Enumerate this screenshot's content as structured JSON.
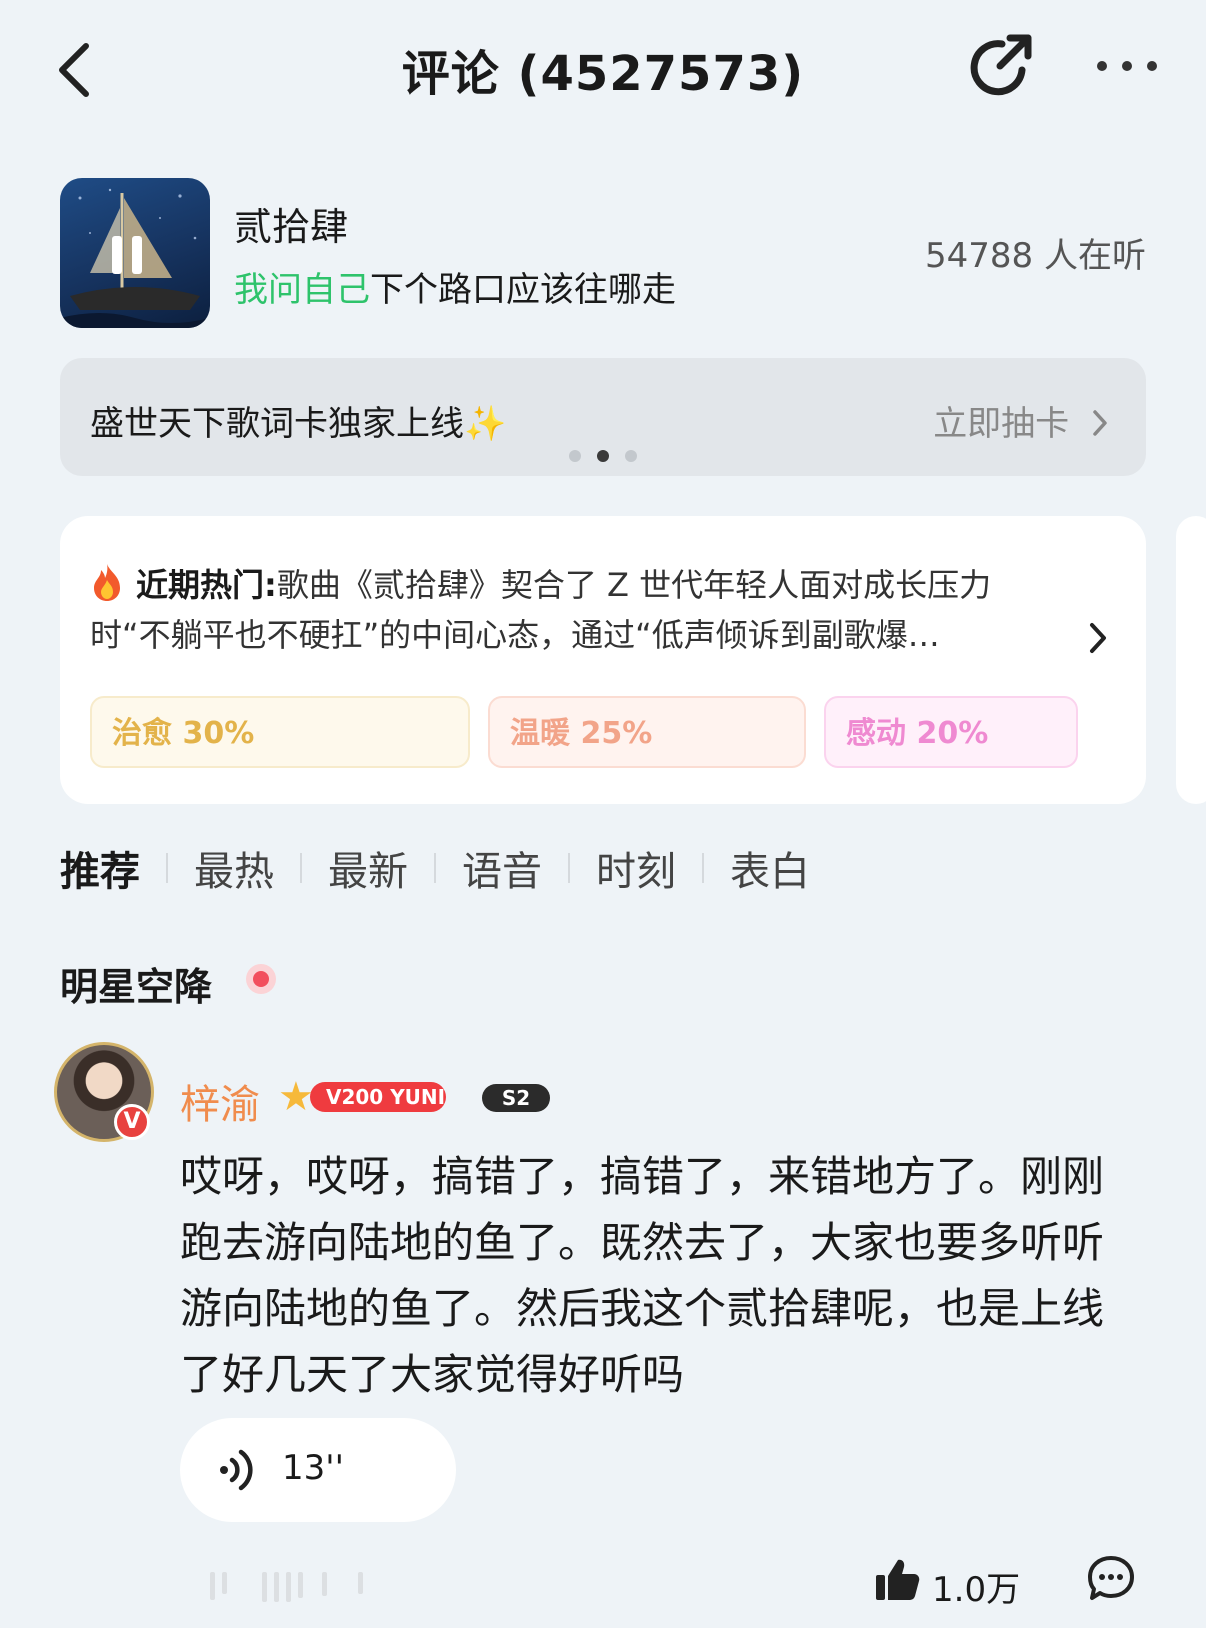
{
  "header": {
    "title": "评论 (4527573)"
  },
  "song": {
    "title": "贰拾肆",
    "lyric_highlight": "我问自己",
    "lyric_rest": "下个路口应该往哪走",
    "listeners": "54788 人在听"
  },
  "banner": {
    "text": "盛世天下歌词卡独家上线✨",
    "action": "立即抽卡"
  },
  "hot": {
    "label": "近期热门:",
    "text": "歌曲《贰拾肆》契合了 Z 世代年轻人面对成长压力时“不躺平也不硬扛”的中间心态，通过“低声倾诉到副歌爆…",
    "tags": [
      {
        "label": "治愈 30%",
        "color": "#e3b34a",
        "bg": "#fef9ec",
        "border": "#f7ebcb"
      },
      {
        "label": "温暖 25%",
        "color": "#f2a489",
        "bg": "#fff3ef",
        "border": "#fbdcd2"
      },
      {
        "label": "感动 20%",
        "color": "#ef8ad1",
        "bg": "#fff0fa",
        "border": "#fbd3ee"
      }
    ]
  },
  "tabs": [
    "推荐",
    "最热",
    "最新",
    "语音",
    "时刻",
    "表白"
  ],
  "section": {
    "title": "明星空降"
  },
  "comment": {
    "username": "梓渝",
    "vip_label": "V200 YUNI",
    "season_badge": "S2",
    "v_badge": "V",
    "text": "哎呀，哎呀，搞错了，搞错了，来错地方了。刚刚跑去游向陆地的鱼了。既然去了，大家也要多听听游向陆地的鱼了。然后我这个贰拾肆呢，也是上线了好几天了大家觉得好听吗",
    "voice_duration": "13''",
    "likes": "1.0万"
  },
  "icons": {
    "back": "back-chevron-icon",
    "share": "share-icon",
    "more": "more-dots-icon",
    "fire": "fire-icon",
    "like": "thumbs-up-icon",
    "reply": "chat-bubble-icon",
    "voice": "sound-wave-icon"
  },
  "colors": {
    "accent_green": "#2ec36b",
    "username_orange": "#f08c4d",
    "live_red": "#f24f5d",
    "vip_red": "#ef3b3f",
    "background": "#eef3f7"
  }
}
